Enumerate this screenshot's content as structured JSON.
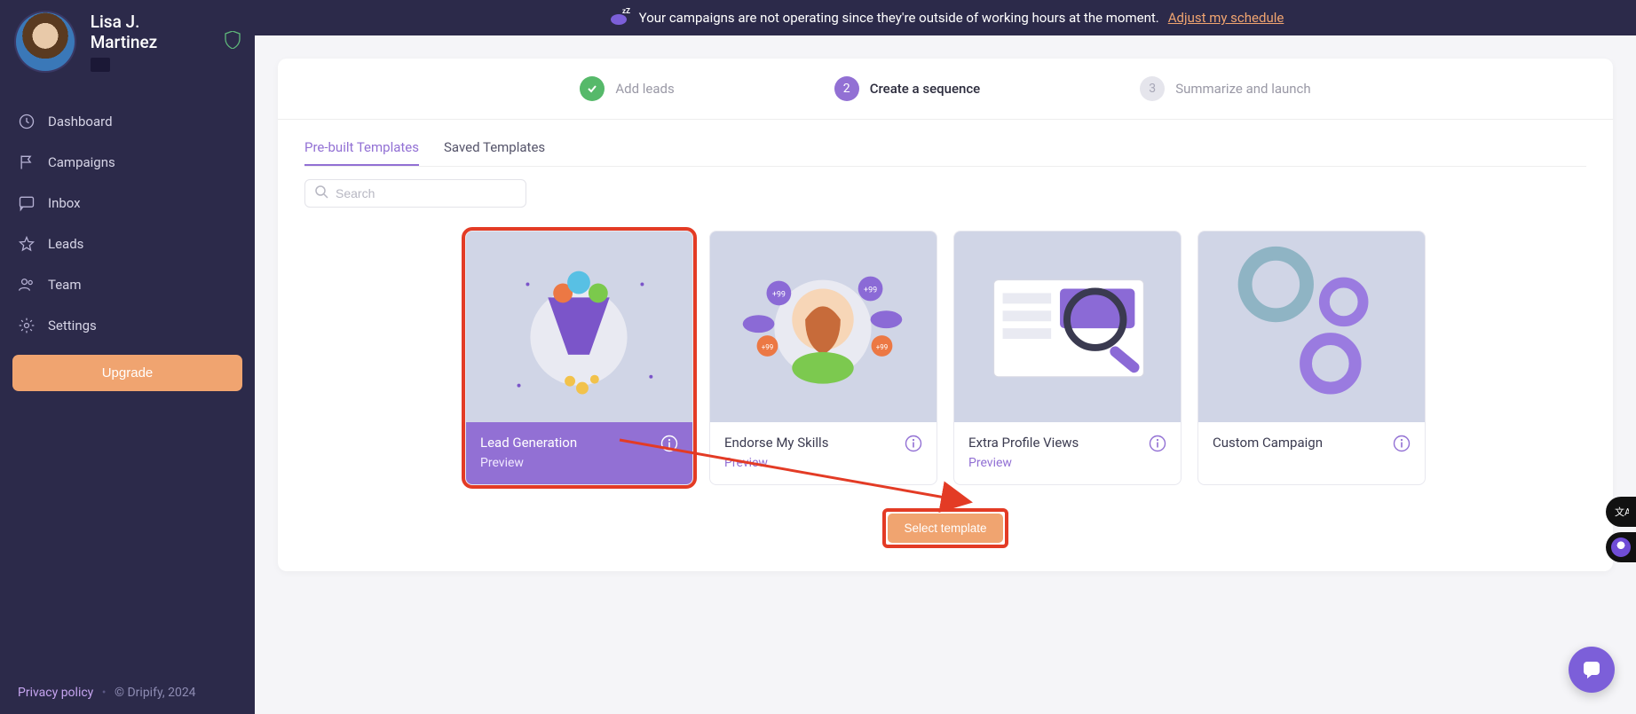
{
  "profile": {
    "name": "Lisa J. Martinez"
  },
  "sidebar": {
    "items": [
      {
        "label": "Dashboard"
      },
      {
        "label": "Campaigns"
      },
      {
        "label": "Inbox"
      },
      {
        "label": "Leads"
      },
      {
        "label": "Team"
      },
      {
        "label": "Settings"
      }
    ],
    "upgrade_label": "Upgrade"
  },
  "notice": {
    "text": "Your campaigns are not operating since they're outside of working hours at the moment.",
    "link_label": "Adjust my schedule"
  },
  "stepper": {
    "step1": {
      "label": "Add leads"
    },
    "step2": {
      "num": "2",
      "label": "Create a sequence"
    },
    "step3": {
      "num": "3",
      "label": "Summarize and launch"
    }
  },
  "tabs": {
    "prebuilt": "Pre-built Templates",
    "saved": "Saved Templates"
  },
  "search": {
    "placeholder": "Search"
  },
  "templates": [
    {
      "title": "Lead Generation",
      "preview": "Preview",
      "selected": true,
      "has_preview": true
    },
    {
      "title": "Endorse My Skills",
      "preview": "Preview",
      "selected": false,
      "has_preview": true
    },
    {
      "title": "Extra Profile Views",
      "preview": "Preview",
      "selected": false,
      "has_preview": true
    },
    {
      "title": "Custom Campaign",
      "preview": "",
      "selected": false,
      "has_preview": false
    }
  ],
  "select_btn": "Select template",
  "footer": {
    "privacy": "Privacy policy",
    "copyright": "© Dripify, 2024"
  },
  "colors": {
    "accent": "#9270d4",
    "sidebar_bg": "#2c2a4a",
    "orange": "#f0a470",
    "highlight": "#e33b25"
  }
}
